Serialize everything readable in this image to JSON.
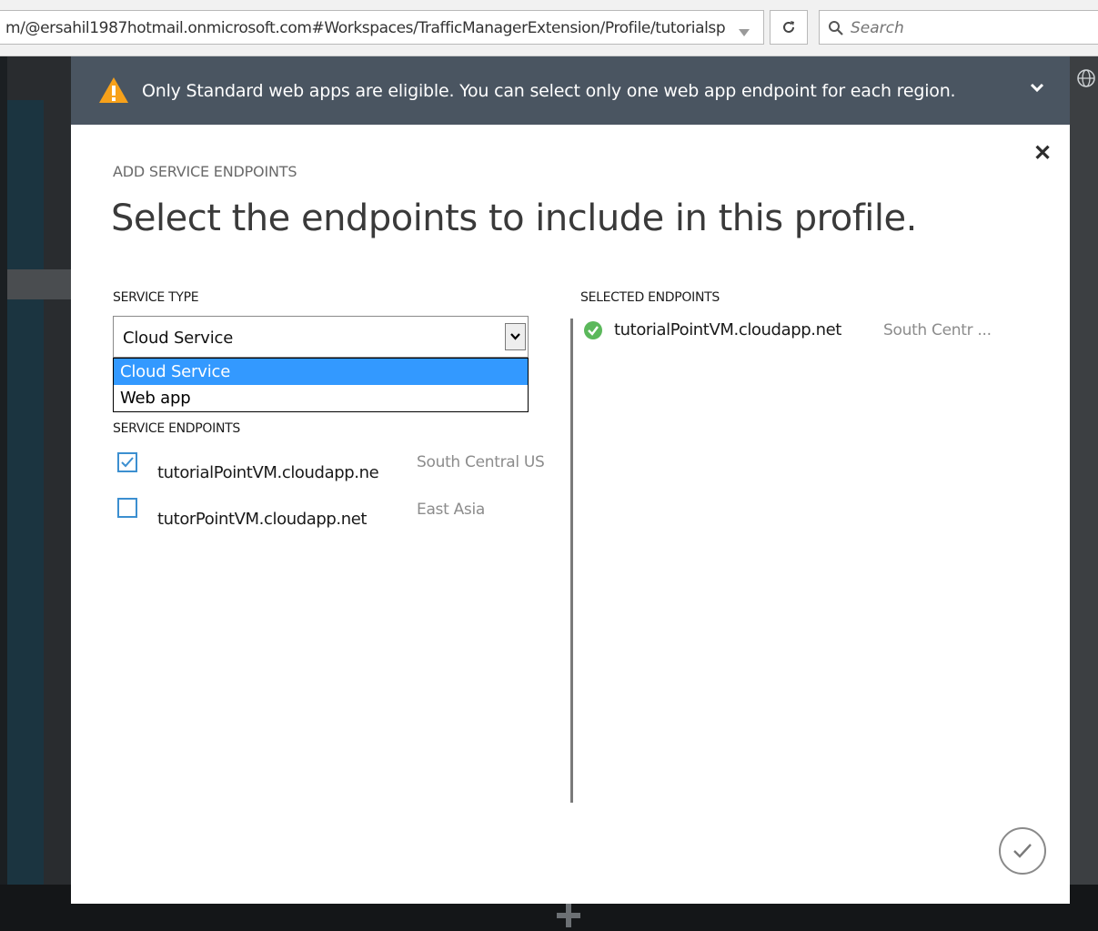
{
  "browser": {
    "url": "m/@ersahil1987hotmail.onmicrosoft.com#Workspaces/TrafficManagerExtension/Profile/tutorialsp",
    "search_placeholder": "Search"
  },
  "notification": {
    "message": "Only Standard web apps are eligible. You can select only one web app endpoint for each region."
  },
  "dialog": {
    "eyebrow": "ADD SERVICE ENDPOINTS",
    "heading": "Select the endpoints to include in this profile.",
    "service_type": {
      "label": "SERVICE TYPE",
      "value": "Cloud Service",
      "options": [
        "Cloud Service",
        "Web app"
      ],
      "highlighted_option": "Cloud Service"
    },
    "service_endpoints": {
      "label": "SERVICE ENDPOINTS",
      "items": [
        {
          "name": "tutorialPointVM.cloudapp.ne",
          "region": "South Central US",
          "checked": true
        },
        {
          "name": "tutorPointVM.cloudapp.net",
          "region": "East Asia",
          "checked": false
        }
      ]
    },
    "selected_endpoints": {
      "label": "SELECTED ENDPOINTS",
      "items": [
        {
          "name": "tutorialPointVM.cloudapp.net",
          "region": "South Centr ..."
        }
      ]
    }
  },
  "colors": {
    "notice_bg": "#4a5561",
    "warning": "#f7a11a",
    "accent_blue": "#3c8fd0",
    "highlight": "#3399ff",
    "success": "#5bb85b"
  },
  "icons": [
    "warning-icon",
    "chevron-down-icon",
    "close-icon",
    "check-icon",
    "reload-icon",
    "search-icon",
    "globe-icon",
    "plus-icon",
    "checkmark-circle-icon"
  ]
}
